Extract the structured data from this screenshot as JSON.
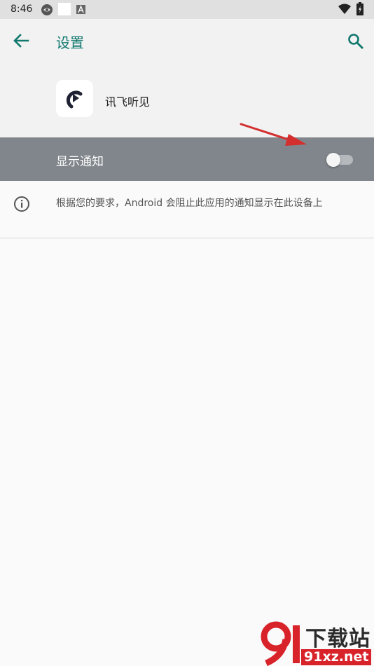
{
  "status_bar": {
    "time": "8:46"
  },
  "app_bar": {
    "title": "设置"
  },
  "app": {
    "name": "讯飞听见"
  },
  "notification_setting": {
    "label": "显示通知",
    "enabled": false
  },
  "info": {
    "text": "根据您的要求，Android 会阻止此应用的通知显示在此设备上"
  },
  "watermark": {
    "title": "下载站",
    "url": "91xz.net"
  },
  "colors": {
    "accent": "#11786e",
    "app_bar_bg": "#f2f2f2",
    "highlight_row_bg": "#80868b",
    "annotation_arrow": "#d32f2f"
  },
  "icons": [
    "eye-symbol-icon",
    "blank-notification-icon",
    "a-notification-icon",
    "wifi-icon",
    "battery-icon",
    "back-arrow-icon",
    "search-icon",
    "app-logo-icon",
    "info-icon",
    "red-arrow-annotation"
  ]
}
